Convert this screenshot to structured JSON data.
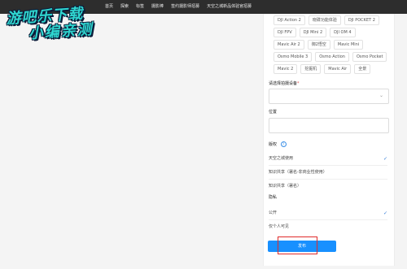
{
  "nav": {
    "items": [
      "首页",
      "探索",
      "标签",
      "摄影棒",
      "签约摄影师招募",
      "天空之城新品体验官招募"
    ]
  },
  "watermark": {
    "line1": "游吧乐下载",
    "line2": "小编亲测"
  },
  "devices": {
    "chips": [
      "DJI Action 2",
      "晓碟功能体验",
      "DJI POCKET 2",
      "DJI FPV",
      "DJI Mini 2",
      "DJI OM 4",
      "Mavic Air 2",
      "御2悟空",
      "Mavic Mini",
      "Osmo Mobile 3",
      "Osmo Action",
      "Osmo Pocket",
      "Mavic 2",
      "挖掘机",
      "Mavic Air",
      "全景"
    ]
  },
  "form": {
    "device_label": "请选择拍摄设备",
    "device_required": "*",
    "location_label": "位置",
    "license_label": "版权",
    "license_help": "?",
    "license_options": [
      "天空之城使用",
      "知识共享（署名-非商业性使用）",
      "知识共享（署名）"
    ],
    "privacy_label": "隐私",
    "privacy_options": [
      "公开",
      "仅个人可见"
    ],
    "publish_label": "发布"
  },
  "colors": {
    "accent": "#1890ff",
    "highlight": "#e02b2b",
    "check": "#2f7bd8"
  }
}
